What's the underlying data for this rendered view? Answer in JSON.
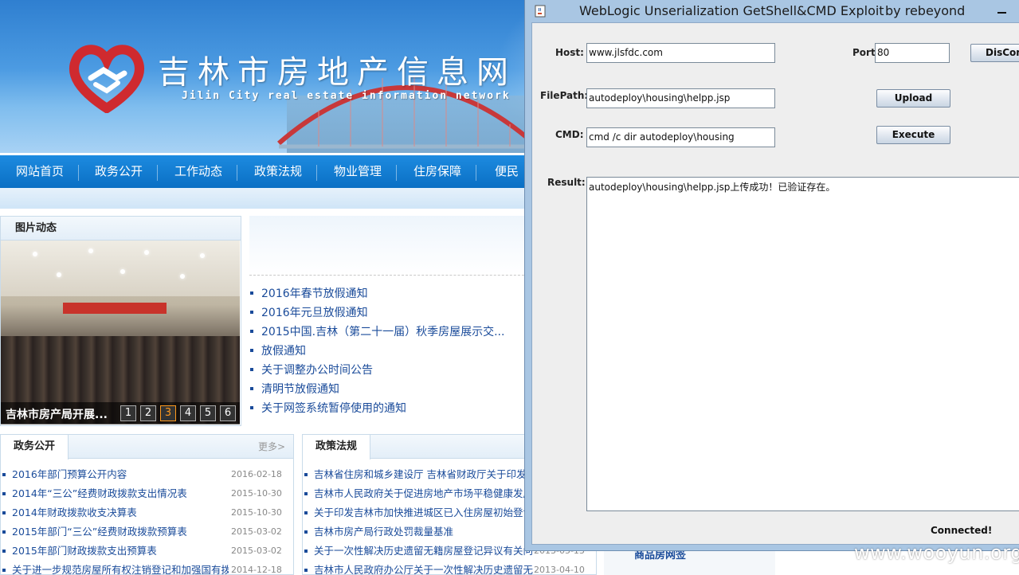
{
  "site": {
    "title": "吉林市房地产信息网",
    "subtitle": "Jilin City real estate information network",
    "nav": [
      "网站首页",
      "政务公开",
      "工作动态",
      "政策法规",
      "物业管理",
      "住房保障",
      "便民服"
    ],
    "photo_section": {
      "heading": "图片动态",
      "caption": "吉林市房产局开展...",
      "pages": [
        "1",
        "2",
        "3",
        "4",
        "5",
        "6"
      ],
      "active_page": "3"
    },
    "news": [
      "2016年春节放假通知",
      "2016年元旦放假通知",
      "2015中国.吉林（第二十一届）秋季房屋展示交...",
      "放假通知",
      "关于调整办公时间公告",
      "清明节放假通知",
      "关于网签系统暂停使用的通知"
    ],
    "gov_section": {
      "heading": "政务公开",
      "more": "更多>",
      "items": [
        {
          "title": "2016年部门预算公开内容",
          "date": "2016-02-18"
        },
        {
          "title": "2014年“三公”经费财政拨款支出情况表",
          "date": "2015-10-30"
        },
        {
          "title": "2014年财政拨款收支决算表",
          "date": "2015-10-30"
        },
        {
          "title": "2015年部门“三公”经费财政拨款预算表",
          "date": "2015-03-02"
        },
        {
          "title": "2015年部门财政拨款支出预算表",
          "date": "2015-03-02"
        },
        {
          "title": "关于进一步规范房屋所有权注销登记和加强国有拨...",
          "date": "2014-12-18"
        }
      ]
    },
    "policy_section": {
      "heading": "政策法规",
      "items": [
        {
          "title": "吉林省住房和城乡建设厅 吉林省财政厅关于印发...",
          "date": ""
        },
        {
          "title": "吉林市人民政府关于促进房地产市场平稳健康发展",
          "date": ""
        },
        {
          "title": "关于印发吉林市加快推进城区已入住房屋初始登记",
          "date": ""
        },
        {
          "title": "吉林市房产局行政处罚裁量基准",
          "date": ""
        },
        {
          "title": "关于一次性解决历史遗留无籍房屋登记异议有关问...",
          "date": "2013-05-13"
        },
        {
          "title": "吉林市人民政府办公厅关于一次性解决历史遗留无...",
          "date": "2013-04-10"
        }
      ]
    },
    "hidden_panel_label": "商品房网签"
  },
  "window": {
    "title": "WebLogic Unserialization GetShell&CMD Exploit",
    "author": "by rebeyond",
    "host_label": "Host:",
    "host_value": "www.jlsfdc.com",
    "port_label": "Port:",
    "port_value": "80",
    "disconnect_label": "DisConnect",
    "filepath_label": "FilePath:",
    "filepath_value": "autodeploy\\housing\\helpp.jsp",
    "upload_label": "Upload",
    "cmd_label": "CMD:",
    "cmd_value": "cmd /c dir autodeploy\\housing",
    "execute_label": "Execute",
    "result_label": "Result:",
    "result_text": "autodeploy\\housing\\helpp.jsp上传成功！已验证存在。",
    "status": "Connected!"
  },
  "watermark": "www.wooyun.org",
  "colors": {
    "nav_blue": "#0a6fc4",
    "window_frame": "#a9c6e3",
    "link_blue": "#1a4b9a",
    "active_pager": "#ff9a1f"
  },
  "icons": {
    "logo": "heart-handshake-logo",
    "app": "java-cup-icon",
    "minimize": "minimize-icon"
  }
}
